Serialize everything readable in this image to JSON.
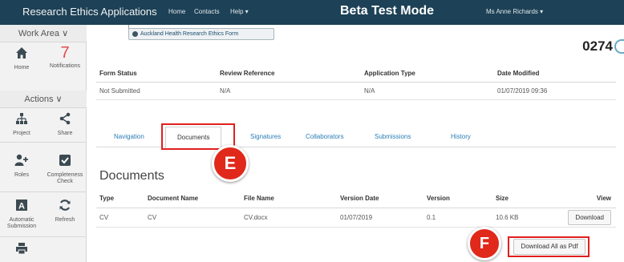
{
  "topbar": {
    "app_title": "Research Ethics Applications",
    "nav_home": "Home",
    "nav_contacts": "Contacts",
    "nav_help": "Help ▾",
    "beta_label": "Beta Test Mode",
    "user_menu": "Ms Anne Richards ▾"
  },
  "sidebar": {
    "work_area": "Work Area ∨",
    "actions": "Actions ∨",
    "notifications_count": "7",
    "tiles": {
      "home": "Home",
      "notifications": "Notifications",
      "project": "Project",
      "share": "Share",
      "roles": "Roles",
      "completeness_check": "Completeness Check",
      "automatic_submission": "Automatic Submission",
      "refresh": "Refresh"
    }
  },
  "header": {
    "form_name": "Auckland Health Research Ethics Form",
    "application_number": "0274"
  },
  "status_table": {
    "columns": [
      "Form Status",
      "Review Reference",
      "Application Type",
      "Date Modified"
    ],
    "row": [
      "Not Submitted",
      "N/A",
      "N/A",
      "01/07/2019 09:36"
    ]
  },
  "tabs": [
    {
      "label": "Navigation"
    },
    {
      "label": "Documents"
    },
    {
      "label": "Signatures"
    },
    {
      "label": "Collaborators"
    },
    {
      "label": "Submissions"
    },
    {
      "label": "History"
    }
  ],
  "annotations": {
    "badge_e": "E",
    "badge_f": "F",
    "highlight_color": "#e11f1f"
  },
  "documents": {
    "title": "Documents",
    "columns": [
      "Type",
      "Document Name",
      "File Name",
      "Version Date",
      "Version",
      "Size",
      "View"
    ],
    "rows": [
      {
        "type": "CV",
        "document_name": "CV",
        "file_name": "CV.docx",
        "version_date": "01/07/2019",
        "version": "0.1",
        "size": "10.6 KB",
        "view_button": "Download"
      }
    ],
    "download_all_button": "Download All as Pdf"
  },
  "colors": {
    "topbar": "#1d4156",
    "link": "#2b7db5",
    "accent_red": "#e0281b"
  }
}
